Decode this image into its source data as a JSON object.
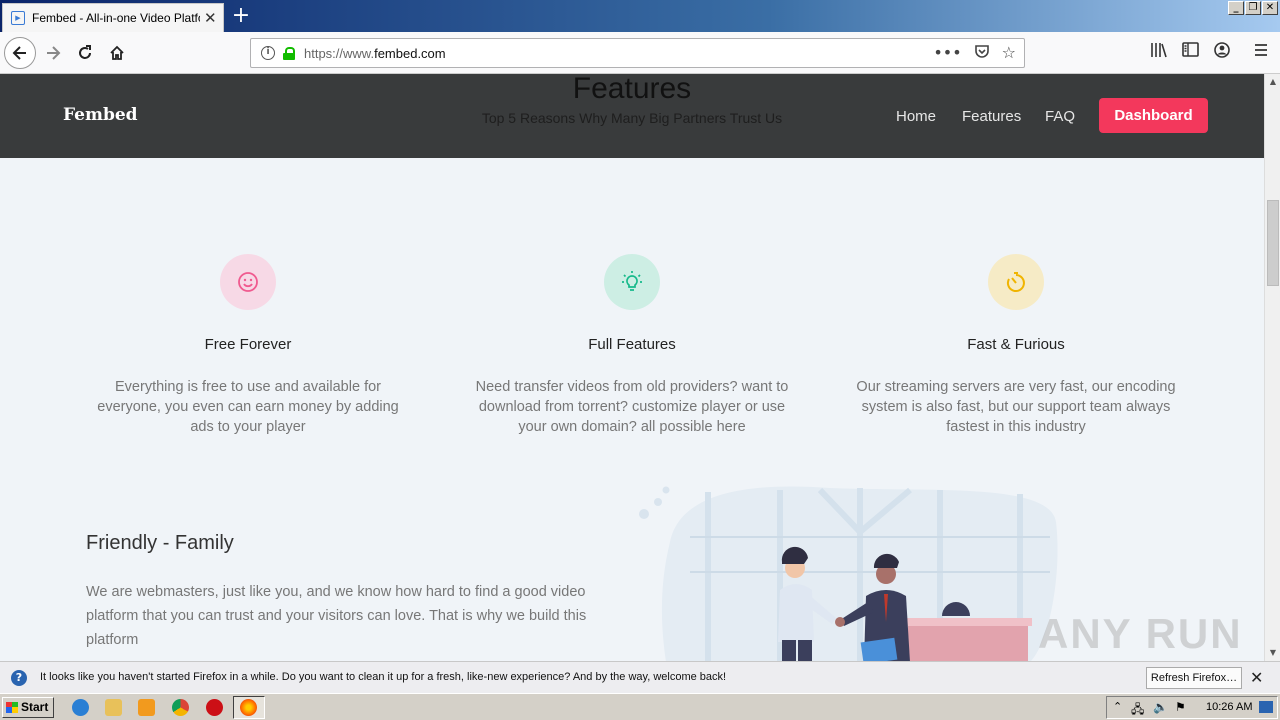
{
  "browser": {
    "tab_title": "Fembed - All-in-one Video Platform",
    "url_prefix": "https://www.",
    "url_domain": "fembed.com"
  },
  "site": {
    "logo": "Fembed",
    "nav": [
      "Home",
      "Features",
      "FAQ"
    ],
    "dashboard_label": "Dashboard",
    "features_title": "Features",
    "features_subtitle": "Top 5 Reasons Why Many Big Partners Trust Us",
    "cards": [
      {
        "title": "Free Forever",
        "desc": "Everything is free to use and available for everyone, you even can earn money by adding ads to your player",
        "icon": "smile-icon",
        "color": "#f05a8f",
        "bg": "#f7d9e6"
      },
      {
        "title": "Full Features",
        "desc": "Need transfer videos from old providers? want to download from torrent? customize player or use your own domain? all possible here",
        "icon": "lightbulb-icon",
        "color": "#16b98a",
        "bg": "#cdeee4"
      },
      {
        "title": "Fast & Furious",
        "desc": "Our streaming servers are very fast, our encoding system is also fast, but our support team always fastest in this industry",
        "icon": "stopwatch-icon",
        "color": "#f0b400",
        "bg": "#f6ebc6"
      }
    ],
    "friendly_title": "Friendly - Family",
    "friendly_text": "We are webmasters, just like you, and we know how hard to find a good video platform that you can trust and your visitors can love. That is why we build this platform"
  },
  "notification": {
    "text": "It looks like you haven't started Firefox in a while. Do you want to clean it up for a fresh, like-new experience? And by the way, welcome back!",
    "button": "Refresh Firefox…"
  },
  "taskbar": {
    "start": "Start",
    "clock": "10:26 AM"
  },
  "watermark": "ANY RUN"
}
